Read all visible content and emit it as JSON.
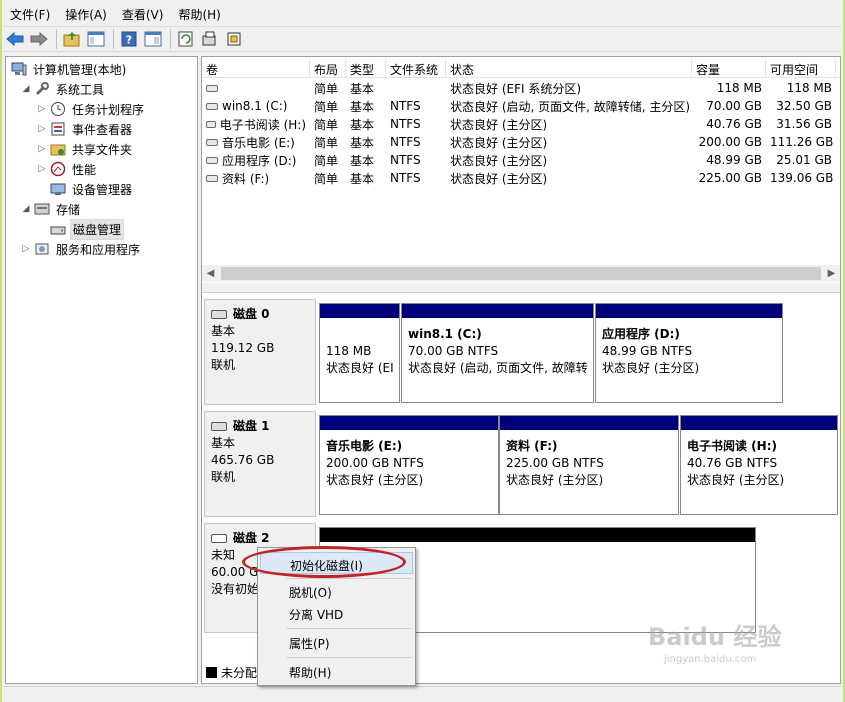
{
  "menubar": {
    "items": [
      "文件(F)",
      "操作(A)",
      "查看(V)",
      "帮助(H)"
    ]
  },
  "toolbar": {
    "buttons": [
      "back-icon",
      "forward-icon",
      "up-folder-icon",
      "show-tree-icon",
      "help-icon",
      "properties-pane-icon",
      "refresh-icon",
      "rescan-icon",
      "settings-icon"
    ]
  },
  "tree": {
    "root": "计算机管理(本地)",
    "system_tools": "系统工具",
    "task_scheduler": "任务计划程序",
    "event_viewer": "事件查看器",
    "shared_folders": "共享文件夹",
    "performance": "性能",
    "device_manager": "设备管理器",
    "storage": "存储",
    "disk_management": "磁盘管理",
    "services": "服务和应用程序"
  },
  "volume_list": {
    "columns": [
      "卷",
      "布局",
      "类型",
      "文件系统",
      "状态",
      "容量",
      "可用空间"
    ],
    "rows": [
      {
        "volume": "",
        "layout": "简单",
        "type": "基本",
        "fs": "",
        "status": "状态良好 (EFI 系统分区)",
        "capacity": "118 MB",
        "free": "118 MB"
      },
      {
        "volume": "win8.1 (C:)",
        "layout": "简单",
        "type": "基本",
        "fs": "NTFS",
        "status": "状态良好 (启动, 页面文件, 故障转储, 主分区)",
        "capacity": "70.00 GB",
        "free": "32.50 GB"
      },
      {
        "volume": "电子书阅读 (H:)",
        "layout": "简单",
        "type": "基本",
        "fs": "NTFS",
        "status": "状态良好 (主分区)",
        "capacity": "40.76 GB",
        "free": "31.56 GB"
      },
      {
        "volume": "音乐电影 (E:)",
        "layout": "简单",
        "type": "基本",
        "fs": "NTFS",
        "status": "状态良好 (主分区)",
        "capacity": "200.00 GB",
        "free": "111.26 GB"
      },
      {
        "volume": "应用程序 (D:)",
        "layout": "简单",
        "type": "基本",
        "fs": "NTFS",
        "status": "状态良好 (主分区)",
        "capacity": "48.99 GB",
        "free": "25.01 GB"
      },
      {
        "volume": "资料 (F:)",
        "layout": "简单",
        "type": "基本",
        "fs": "NTFS",
        "status": "状态良好 (主分区)",
        "capacity": "225.00 GB",
        "free": "139.06 GB"
      }
    ]
  },
  "disks": {
    "disk0": {
      "name": "磁盘 0",
      "type": "基本",
      "size": "119.12 GB",
      "state": "联机",
      "p1": {
        "title": "",
        "size": "118 MB",
        "status": "状态良好 (EI"
      },
      "p2": {
        "title": "win8.1  (C:)",
        "size": "70.00 GB NTFS",
        "status": "状态良好 (启动, 页面文件, 故障转"
      },
      "p3": {
        "title": "应用程序  (D:)",
        "size": "48.99 GB NTFS",
        "status": "状态良好 (主分区)"
      }
    },
    "disk1": {
      "name": "磁盘 1",
      "type": "基本",
      "size": "465.76 GB",
      "state": "联机",
      "p1": {
        "title": "音乐电影  (E:)",
        "size": "200.00 GB NTFS",
        "status": "状态良好 (主分区)"
      },
      "p2": {
        "title": "资料  (F:)",
        "size": "225.00 GB NTFS",
        "status": "状态良好 (主分区)"
      },
      "p3": {
        "title": "电子书阅读  (H:)",
        "size": "40.76 GB NTFS",
        "status": "状态良好 (主分区)"
      }
    },
    "disk2": {
      "name": "磁盘 2",
      "type": "未知",
      "size": "60.00 G",
      "state": "没有初始"
    }
  },
  "legend": {
    "unallocated": "未分配"
  },
  "context_menu": {
    "initialize": "初始化磁盘(I)",
    "offline": "脱机(O)",
    "detach_vhd": "分离 VHD",
    "properties": "属性(P)",
    "help": "帮助(H)"
  },
  "watermark": {
    "brand": "Baidu 经验",
    "url": "jingyan.baidu.com"
  },
  "colors": {
    "partition_bar": "#00007b",
    "unallocated_bar": "#000000",
    "highlight_ring": "#c0242a"
  }
}
